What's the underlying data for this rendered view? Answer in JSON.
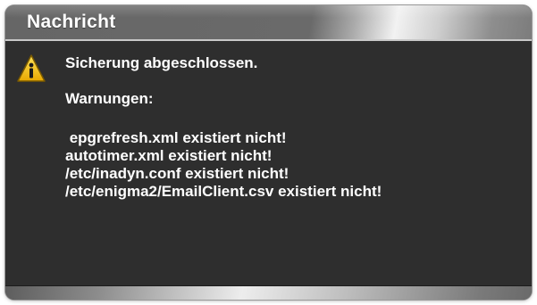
{
  "dialog": {
    "title": "Nachricht",
    "icon": "warning-icon",
    "message": "Sicherung abgeschlossen.",
    "warnings_label": "Warnungen:",
    "warnings": [
      " epgrefresh.xml existiert nicht!",
      "autotimer.xml existiert nicht!",
      "/etc/inadyn.conf existiert nicht!",
      "/etc/enigma2/EmailClient.csv existiert nicht!"
    ]
  },
  "colors": {
    "background": "#2e2e2e",
    "text": "#ffffff",
    "warning_yellow": "#f5c400"
  }
}
